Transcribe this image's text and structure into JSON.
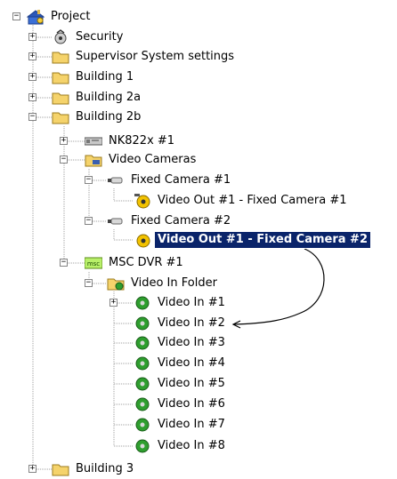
{
  "tree": {
    "root": {
      "label": "Project",
      "icon": "project-icon"
    },
    "items": [
      {
        "label": "Security",
        "icon": "security-icon"
      },
      {
        "label": "Supervisor System settings",
        "icon": "folder-icon"
      },
      {
        "label": "Building 1",
        "icon": "folder-icon"
      },
      {
        "label": "Building 2a",
        "icon": "folder-icon"
      },
      {
        "label": "Building 2b",
        "icon": "folder-icon"
      },
      {
        "label": "NK822x #1",
        "icon": "device-icon"
      },
      {
        "label": "Video Cameras",
        "icon": "camera-folder-icon"
      },
      {
        "label": "Fixed Camera #1",
        "icon": "fixed-camera-icon"
      },
      {
        "label": "Video Out #1 - Fixed Camera #1",
        "icon": "video-out-icon"
      },
      {
        "label": "Fixed Camera #2",
        "icon": "fixed-camera-icon"
      },
      {
        "label": "Video Out #1 - Fixed Camera #2",
        "icon": "video-out-icon",
        "selected": true
      },
      {
        "label": "MSC DVR #1",
        "icon": "msc-icon",
        "badge": "msc"
      },
      {
        "label": "Video In Folder",
        "icon": "video-in-folder-icon"
      },
      {
        "label": "Video In #1",
        "icon": "video-in-icon"
      },
      {
        "label": "Video In #2",
        "icon": "video-in-icon"
      },
      {
        "label": "Video In #3",
        "icon": "video-in-icon"
      },
      {
        "label": "Video In #4",
        "icon": "video-in-icon"
      },
      {
        "label": "Video In #5",
        "icon": "video-in-icon"
      },
      {
        "label": "Video In #6",
        "icon": "video-in-icon"
      },
      {
        "label": "Video In #7",
        "icon": "video-in-icon"
      },
      {
        "label": "Video In #8",
        "icon": "video-in-icon"
      },
      {
        "label": "Building 3",
        "icon": "folder-icon"
      }
    ],
    "expander_expanded": "−",
    "expander_collapsed": "+"
  },
  "colors": {
    "selection": "#0a246a",
    "folder": "#f5d36b",
    "video_in": "#2e9e2e",
    "video_out": "#f2c200",
    "msc_badge": "#b9f06a"
  }
}
